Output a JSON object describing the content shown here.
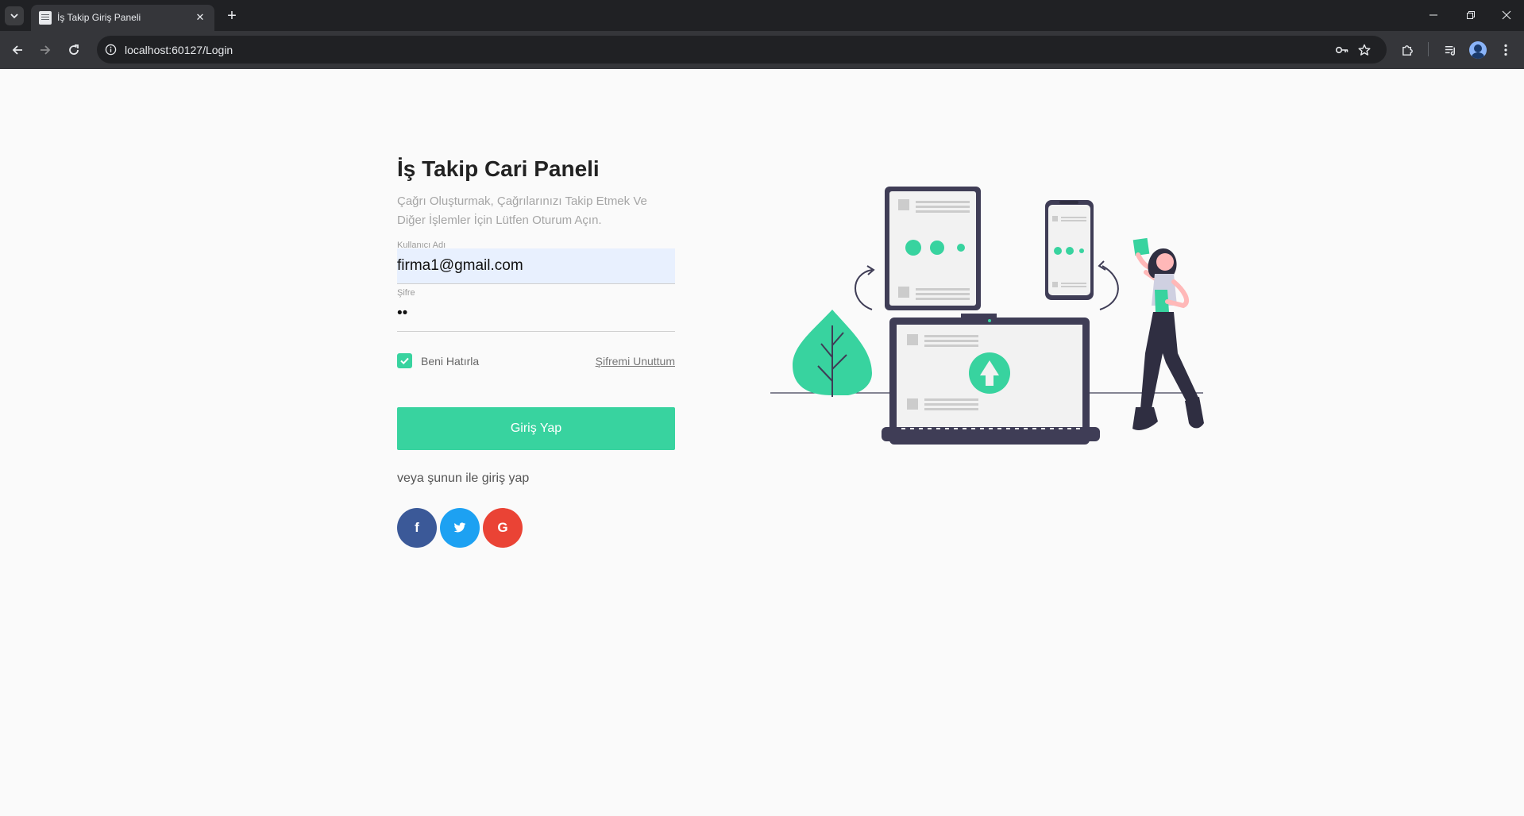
{
  "browser": {
    "tab_title": "İş Takip Giriş Paneli",
    "url": "localhost:60127/Login"
  },
  "page": {
    "title": "İş Takip Cari Paneli",
    "subtitle": "Çağrı Oluşturmak, Çağrılarınızı Takip Etmek Ve Diğer İşlemler İçin Lütfen Oturum Açın.",
    "username_label": "Kullanıcı Adı",
    "username_value": "firma1@gmail.com",
    "password_label": "Şifre",
    "password_value": "••",
    "remember_label": "Beni Hatırla",
    "remember_checked": true,
    "forgot_label": "Şifremi Unuttum",
    "login_button": "Giriş Yap",
    "alt_login_text": "veya şunun ile giriş yap",
    "social": [
      {
        "name": "facebook",
        "glyph": "f",
        "color": "#3b5998"
      },
      {
        "name": "twitter",
        "glyph": "t",
        "color": "#1da1f2"
      },
      {
        "name": "google",
        "glyph": "G",
        "color": "#ea4335"
      }
    ]
  },
  "colors": {
    "accent": "#38d39f",
    "illustration_dark": "#3f3d56",
    "illustration_light": "#f2f2f2"
  }
}
